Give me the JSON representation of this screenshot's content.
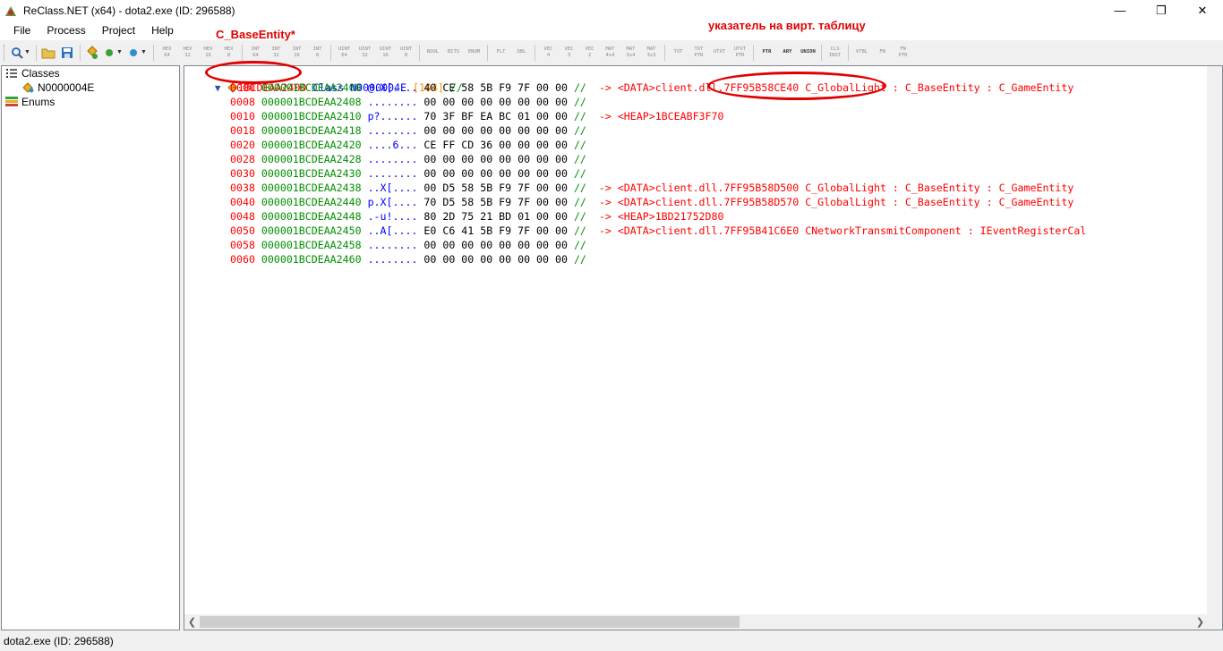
{
  "window": {
    "title": "ReClass.NET (x64) - dota2.exe (ID: 296588)",
    "minimize": "—",
    "restore": "❐",
    "close": "✕"
  },
  "menu": [
    "File",
    "Process",
    "Project",
    "Help"
  ],
  "toolbar": {
    "type_buttons": [
      [
        "HEX",
        "64"
      ],
      [
        "HEX",
        "32"
      ],
      [
        "HEX",
        "16"
      ],
      [
        "HEX",
        "8"
      ],
      [
        "INT",
        "64"
      ],
      [
        "INT",
        "32"
      ],
      [
        "INT",
        "16"
      ],
      [
        "INT",
        "8"
      ],
      [
        "UINT",
        "64"
      ],
      [
        "UINT",
        "32"
      ],
      [
        "UINT",
        "16"
      ],
      [
        "UINT",
        "8"
      ],
      [
        "BOOL",
        ""
      ],
      [
        "BITS",
        ""
      ],
      [
        "ENUM",
        ""
      ],
      [
        "FLT",
        ""
      ],
      [
        "DBL",
        ""
      ],
      [
        "VEC",
        "4"
      ],
      [
        "VEC",
        "3"
      ],
      [
        "VEC",
        "2"
      ],
      [
        "MAT",
        "4x4"
      ],
      [
        "MAT",
        "3x4"
      ],
      [
        "MAT",
        "3x3"
      ],
      [
        "TXT",
        ""
      ],
      [
        "TXT",
        "PTR"
      ],
      [
        "UTXT",
        ""
      ],
      [
        "UTXT",
        "PTR"
      ],
      [
        "PTR",
        ""
      ],
      [
        "ARY",
        ""
      ],
      [
        "UNION",
        ""
      ],
      [
        "CLS",
        "INST"
      ],
      [
        "VTBL",
        ""
      ],
      [
        "FN",
        ""
      ],
      [
        "FN",
        "PTR"
      ]
    ]
  },
  "sidebar": {
    "classes_label": "Classes",
    "class_item": "N0000004E",
    "enums_label": "Enums"
  },
  "editor": {
    "header": {
      "address": "1BCDEAA2400",
      "class_kw": "Class",
      "class_name": "N0000004E",
      "size": "[104]",
      "comment": "//"
    },
    "rows": [
      {
        "off": "0000",
        "addr": "000001BCDEAA2400",
        "txt": "@.X[....",
        "hex": "40 CE 58 5B F9 7F 00 00",
        "cmt": "//",
        "ptr": "-> <DATA>client.dll.7FF95B58CE40 C_GlobalLight : C_BaseEntity : C_GameEntity"
      },
      {
        "off": "0008",
        "addr": "000001BCDEAA2408",
        "txt": "........",
        "hex": "00 00 00 00 00 00 00 00",
        "cmt": "//",
        "ptr": ""
      },
      {
        "off": "0010",
        "addr": "000001BCDEAA2410",
        "txt": "p?......",
        "hex": "70 3F BF EA BC 01 00 00",
        "cmt": "//",
        "ptr": "-> <HEAP>1BCEABF3F70"
      },
      {
        "off": "0018",
        "addr": "000001BCDEAA2418",
        "txt": "........",
        "hex": "00 00 00 00 00 00 00 00",
        "cmt": "//",
        "ptr": ""
      },
      {
        "off": "0020",
        "addr": "000001BCDEAA2420",
        "txt": "....6...",
        "hex": "CE FF CD 36 00 00 00 00",
        "cmt": "//",
        "ptr": ""
      },
      {
        "off": "0028",
        "addr": "000001BCDEAA2428",
        "txt": "........",
        "hex": "00 00 00 00 00 00 00 00",
        "cmt": "//",
        "ptr": ""
      },
      {
        "off": "0030",
        "addr": "000001BCDEAA2430",
        "txt": "........",
        "hex": "00 00 00 00 00 00 00 00",
        "cmt": "//",
        "ptr": ""
      },
      {
        "off": "0038",
        "addr": "000001BCDEAA2438",
        "txt": "..X[....",
        "hex": "00 D5 58 5B F9 7F 00 00",
        "cmt": "//",
        "ptr": "-> <DATA>client.dll.7FF95B58D500 C_GlobalLight : C_BaseEntity : C_GameEntity"
      },
      {
        "off": "0040",
        "addr": "000001BCDEAA2440",
        "txt": "p.X[....",
        "hex": "70 D5 58 5B F9 7F 00 00",
        "cmt": "//",
        "ptr": "-> <DATA>client.dll.7FF95B58D570 C_GlobalLight : C_BaseEntity : C_GameEntity"
      },
      {
        "off": "0048",
        "addr": "000001BCDEAA2448",
        "txt": ".-u!....",
        "hex": "80 2D 75 21 BD 01 00 00",
        "cmt": "//",
        "ptr": "-> <HEAP>1BD21752D80"
      },
      {
        "off": "0050",
        "addr": "000001BCDEAA2450",
        "txt": "..A[....",
        "hex": "E0 C6 41 5B F9 7F 00 00",
        "cmt": "//",
        "ptr": "-> <DATA>client.dll.7FF95B41C6E0 CNetworkTransmitComponent : IEventRegisterCal"
      },
      {
        "off": "0058",
        "addr": "000001BCDEAA2458",
        "txt": "........",
        "hex": "00 00 00 00 00 00 00 00",
        "cmt": "//",
        "ptr": ""
      },
      {
        "off": "0060",
        "addr": "000001BCDEAA2460",
        "txt": "........",
        "hex": "00 00 00 00 00 00 00 00",
        "cmt": "//",
        "ptr": ""
      }
    ]
  },
  "annotations": {
    "base_entity": "C_BaseEntity*",
    "vtable": "указатель на вирт. таблицу"
  },
  "status": "dota2.exe (ID: 296588)"
}
